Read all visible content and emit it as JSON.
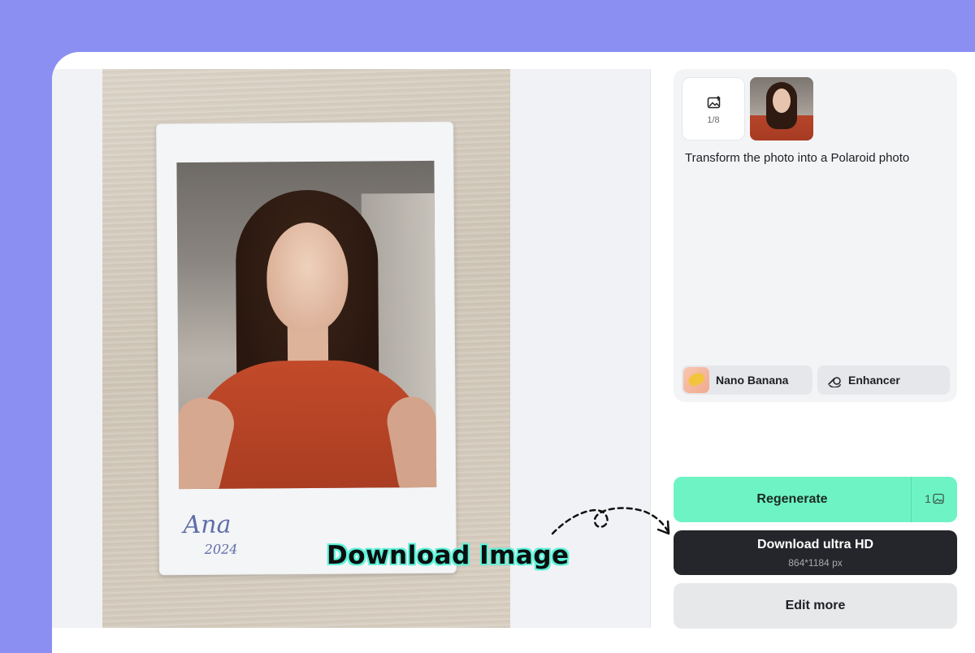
{
  "canvas": {
    "signature_text": "Ana",
    "signature_year": "2024"
  },
  "annotation": {
    "text": "Download Image"
  },
  "panel": {
    "upload_count": "1/8",
    "upload_icon": "image-upload-icon",
    "prompt": "Transform the photo into a Polaroid photo",
    "model_chip": "Nano Banana",
    "tool_chip": "Enhancer",
    "tool_icon": "enhancer-icon"
  },
  "actions": {
    "regenerate_label": "Regenerate",
    "regenerate_cost": "1",
    "cost_icon": "image-credit-icon",
    "download_label": "Download ultra HD",
    "download_size": "864*1184 px",
    "edit_label": "Edit more"
  },
  "colors": {
    "background": "#8b8ff2",
    "regenerate": "#6ef4c4",
    "download": "#25262b",
    "edit": "#e7e8ea",
    "annotation_outline": "#5ff2d8"
  }
}
